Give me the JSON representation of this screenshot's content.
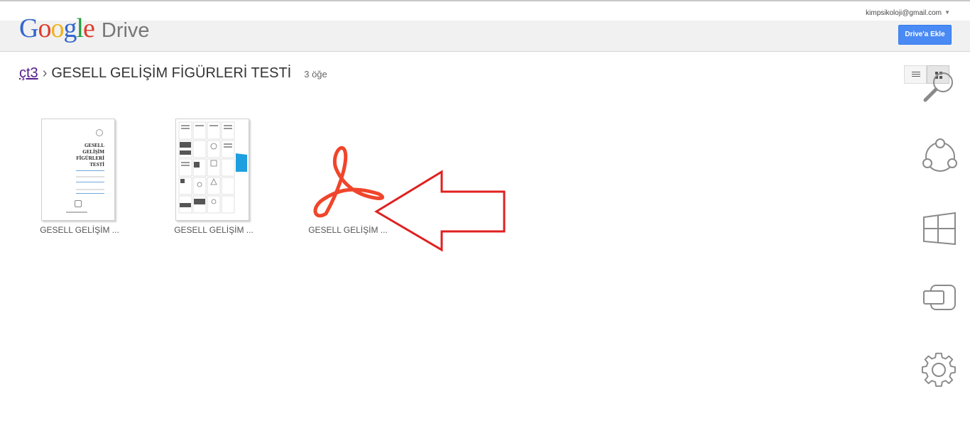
{
  "header": {
    "logo_google": "Google",
    "logo_drive": "Drive",
    "account": "kimpsikoloji@gmail.com",
    "add_button": "Drive'a Ekle"
  },
  "breadcrumb": {
    "parent": "çt3",
    "separator": "›",
    "title": "GESELL GELİŞİM FİGÜRLERİ TESTİ",
    "count": "3 öğe"
  },
  "files": [
    {
      "name": "GESELL GELİŞİM ...",
      "type": "pdf-cover"
    },
    {
      "name": "GESELL GELİŞİM ...",
      "type": "pdf-pages"
    },
    {
      "name": "GESELL GELİŞİM ...",
      "type": "acrobat-icon"
    }
  ],
  "cover": {
    "title_lines": [
      "GESELL",
      "GELİŞİM",
      "FİGÜRLERİ",
      "TESTİ"
    ]
  },
  "colors": {
    "accent_button": "#4a8af4",
    "arrow": "#e02020",
    "acrobat": "#f0452b"
  },
  "side_icons": [
    "search-icon",
    "share-icon",
    "windows-icon",
    "devices-icon",
    "gear-icon"
  ]
}
